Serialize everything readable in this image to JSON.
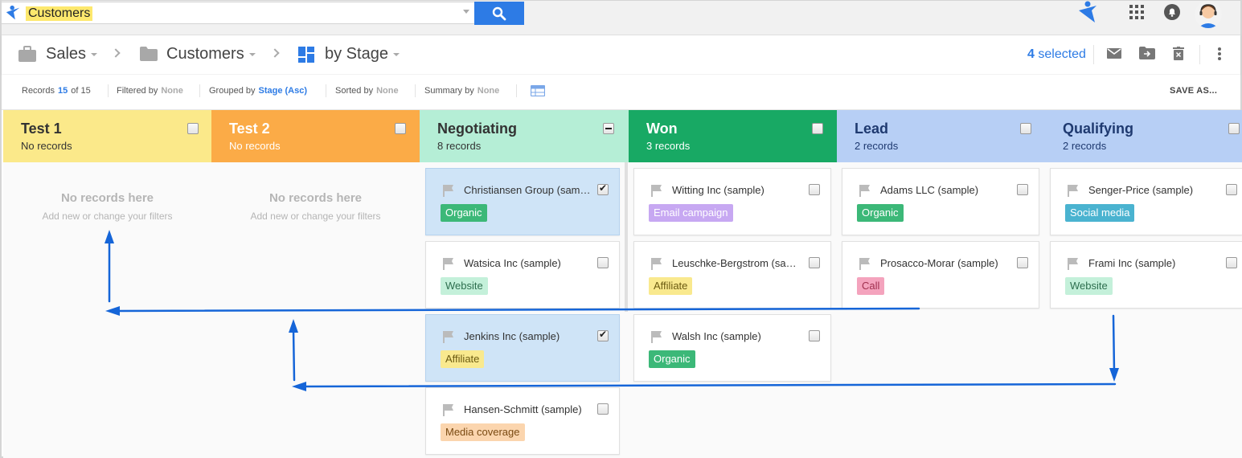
{
  "search": {
    "value": "Customers"
  },
  "breadcrumb": {
    "sales": "Sales",
    "customers": "Customers",
    "view": "by Stage"
  },
  "selection": {
    "count": "4",
    "label": "selected"
  },
  "summary": {
    "records_label": "Records",
    "records_shown": "15",
    "records_total": "of 15",
    "filtered_label": "Filtered by",
    "filtered_value": "None",
    "grouped_label": "Grouped by",
    "grouped_value": "Stage (Asc)",
    "sorted_label": "Sorted by",
    "sorted_value": "None",
    "summary_label": "Summary by",
    "summary_value": "None",
    "save_as": "SAVE AS..."
  },
  "empty": {
    "title": "No records here",
    "subtitle": "Add new or change your filters"
  },
  "columns": [
    {
      "title": "Test 1",
      "count": "No records",
      "bg": "#fbe98a",
      "fg": "#333333"
    },
    {
      "title": "Test 2",
      "count": "No records",
      "bg": "#fbab47",
      "fg": "#ffffff"
    },
    {
      "title": "Negotiating",
      "count": "8 records",
      "bg": "#b5eed6",
      "fg": "#333333"
    },
    {
      "title": "Won",
      "count": "3 records",
      "bg": "#18a964",
      "fg": "#ffffff"
    },
    {
      "title": "Lead",
      "count": "2 records",
      "bg": "#b7cff5",
      "fg": "#1f3a70"
    },
    {
      "title": "Qualifying",
      "count": "2 records",
      "bg": "#b7cff5",
      "fg": "#1f3a70"
    }
  ],
  "cards": {
    "negotiating": [
      {
        "name": "Christiansen Group (sample)",
        "tag": "Organic",
        "checked": true
      },
      {
        "name": "Watsica Inc (sample)",
        "tag": "Website",
        "checked": false
      },
      {
        "name": "Jenkins Inc (sample)",
        "tag": "Affiliate",
        "checked": true
      },
      {
        "name": "Hansen-Schmitt (sample)",
        "tag": "Media coverage",
        "checked": false
      }
    ],
    "won": [
      {
        "name": "Witting Inc (sample)",
        "tag": "Email campaign"
      },
      {
        "name": "Leuschke-Bergstrom (sample)",
        "tag": "Affiliate"
      },
      {
        "name": "Walsh Inc (sample)",
        "tag": "Organic"
      }
    ],
    "lead": [
      {
        "name": "Adams LLC (sample)",
        "tag": "Organic"
      },
      {
        "name": "Prosacco-Morar (sample)",
        "tag": "Call"
      }
    ],
    "qualifying": [
      {
        "name": "Senger-Price (sample)",
        "tag": "Social media"
      },
      {
        "name": "Frami Inc (sample)",
        "tag": "Website"
      }
    ]
  },
  "tag_colors": {
    "Organic": {
      "bg": "#3cb878",
      "fg": "#ffffff"
    },
    "Website": {
      "bg": "#c4f0da",
      "fg": "#2d6e4e"
    },
    "Affiliate": {
      "bg": "#f9e98e",
      "fg": "#6b5a10"
    },
    "Media coverage": {
      "bg": "#fbd5ae",
      "fg": "#7a4a12"
    },
    "Email campaign": {
      "bg": "#c7a8f2",
      "fg": "#ffffff"
    },
    "Call": {
      "bg": "#f4a3bd",
      "fg": "#a0304f"
    },
    "Social media": {
      "bg": "#4ab3d0",
      "fg": "#ffffff"
    }
  },
  "accent": "#2d7be5",
  "arrow_color": "#1565d8"
}
